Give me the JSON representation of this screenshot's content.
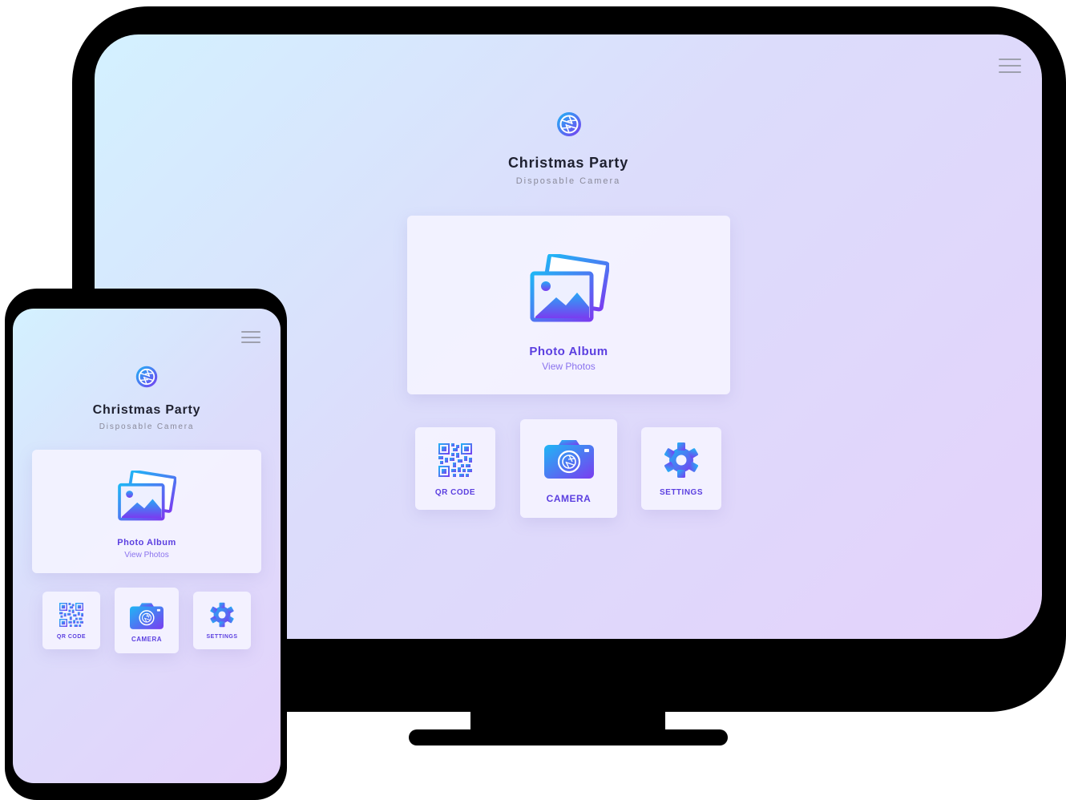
{
  "app": {
    "title": "Christmas Party",
    "subtitle": "Disposable Camera"
  },
  "album": {
    "label": "Photo Album",
    "sublabel": "View Photos"
  },
  "actions": {
    "qr": "QR CODE",
    "camera": "CAMERA",
    "settings": "SETTINGS"
  },
  "icons": {
    "menu": "hamburger-menu-icon",
    "logo": "camera-shutter-logo-icon",
    "album": "photo-album-icon",
    "qr": "qr-code-icon",
    "camera": "camera-icon",
    "settings": "gear-icon"
  },
  "colors": {
    "accent_start": "#1fb6f5",
    "accent_end": "#7a3cf0",
    "label": "#5b3fe0",
    "title": "#1f2130",
    "device": "#000000"
  }
}
